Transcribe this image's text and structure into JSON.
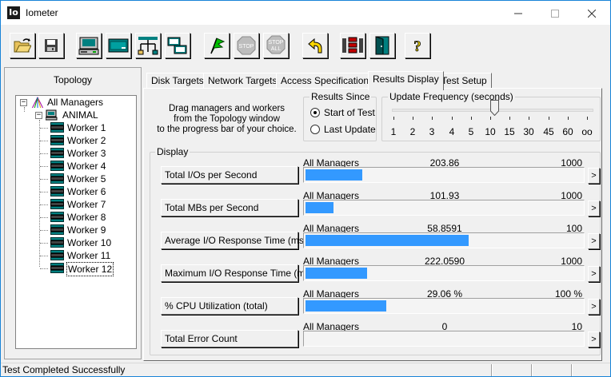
{
  "window": {
    "title": "Iometer",
    "app_icon_text": "Io"
  },
  "toolbar": {
    "buttons": [
      "open-config",
      "save-config",
      "start-disk-worker",
      "start-network-worker",
      "new-manager",
      "duplicate-worker",
      "start-tests",
      "stop-test",
      "stop-all",
      "reset-workers",
      "exit-iometer",
      "about"
    ],
    "stop_text": "STOP",
    "stop_all_text_top": "STOP",
    "stop_all_text_bottom": "ALL",
    "about_text": "?"
  },
  "topology": {
    "label": "Topology",
    "root": "All Managers",
    "manager": "ANIMAL",
    "workers": [
      "Worker 1",
      "Worker 2",
      "Worker 3",
      "Worker 4",
      "Worker 5",
      "Worker 6",
      "Worker 7",
      "Worker 8",
      "Worker 9",
      "Worker 10",
      "Worker 11",
      "Worker 12"
    ]
  },
  "tabs": [
    "Disk Targets",
    "Network Targets",
    "Access Specifications",
    "Results Display",
    "Test Setup"
  ],
  "active_tab": "Results Display",
  "instructions": [
    "Drag managers and workers",
    "from the Topology window",
    "to the progress bar of your choice."
  ],
  "results_since": {
    "label": "Results Since",
    "options": [
      "Start of Test",
      "Last Update"
    ],
    "selected": "Start of Test"
  },
  "update_frequency": {
    "label": "Update Frequency (seconds)",
    "ticks": [
      "1",
      "2",
      "3",
      "4",
      "5",
      "10",
      "15",
      "30",
      "45",
      "60",
      "oo"
    ],
    "selected": "10"
  },
  "display": {
    "label": "Display",
    "rows": [
      {
        "metric": "Total I/Os per Second",
        "manager": "All Managers",
        "value": "203.86",
        "max": "1000",
        "fraction": 0.204
      },
      {
        "metric": "Total MBs per Second",
        "manager": "All Managers",
        "value": "101.93",
        "max": "1000",
        "fraction": 0.102
      },
      {
        "metric": "Average I/O Response Time (ms)",
        "manager": "All Managers",
        "value": "58.8591",
        "max": "100",
        "fraction": 0.589
      },
      {
        "metric": "Maximum I/O Response Time (ms)",
        "manager": "All Managers",
        "value": "222.0590",
        "max": "1000",
        "fraction": 0.222
      },
      {
        "metric": "% CPU Utilization (total)",
        "manager": "All Managers",
        "value": "29.06 %",
        "max": "100 %",
        "fraction": 0.291
      },
      {
        "metric": "Total Error Count",
        "manager": "All Managers",
        "value": "0",
        "max": "10",
        "fraction": 0
      }
    ],
    "arrow_text": ">"
  },
  "status": {
    "text": "Test Completed Successfully"
  },
  "colors": {
    "bar_fill": "#3399ff",
    "window_bg": "#f0f0f0",
    "window_border": "#1883d7"
  }
}
